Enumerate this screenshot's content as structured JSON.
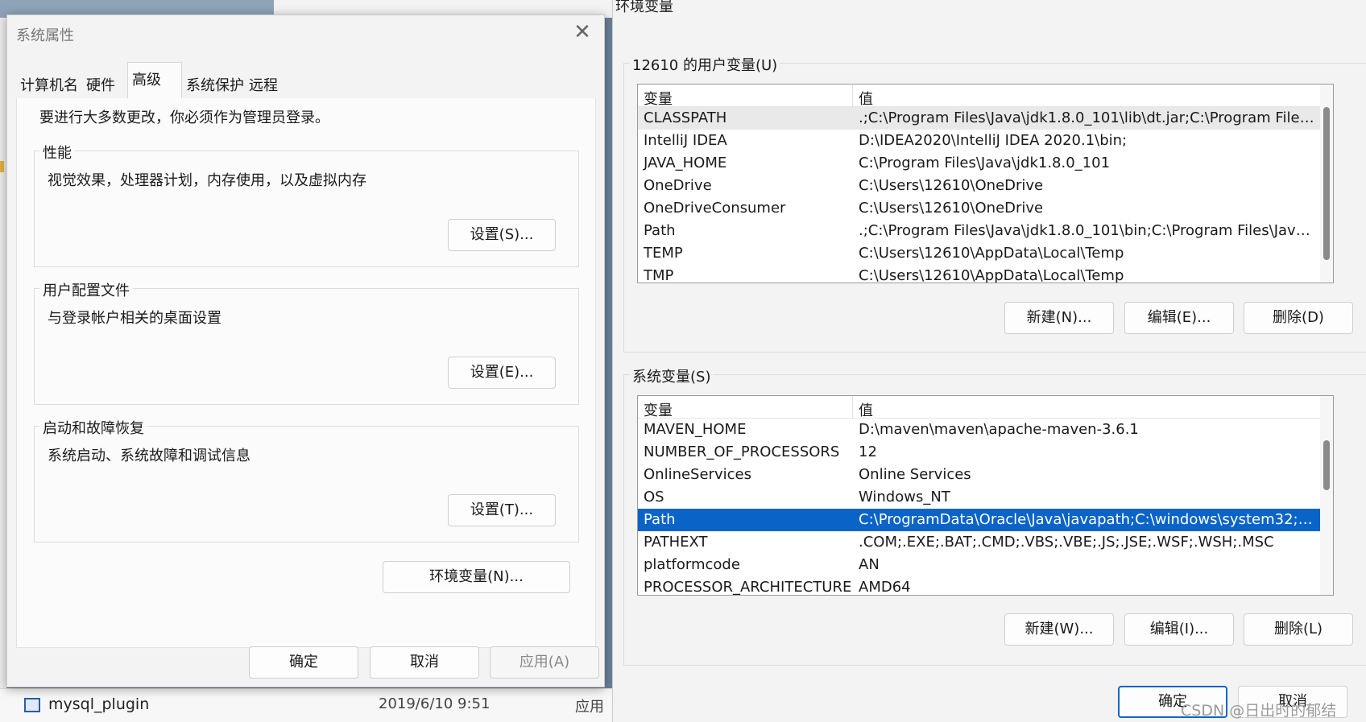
{
  "background": {
    "file_name": "mysql_plugin",
    "file_date": "2019/6/10 9:51",
    "file_type": "应用"
  },
  "system_properties": {
    "title": "系统属性",
    "close_glyph": "✕",
    "tabs": [
      "计算机名",
      "硬件",
      "高级",
      "系统保护",
      "远程"
    ],
    "active_tab": "高级",
    "admin_note": "要进行大多数更改，你必须作为管理员登录。",
    "performance": {
      "title": "性能",
      "description": "视觉效果，处理器计划，内存使用，以及虚拟内存",
      "button": "设置(S)..."
    },
    "user_profiles": {
      "title": "用户配置文件",
      "description": "与登录帐户相关的桌面设置",
      "button": "设置(E)..."
    },
    "startup_recovery": {
      "title": "启动和故障恢复",
      "description": "系统启动、系统故障和调试信息",
      "button": "设置(T)..."
    },
    "env_button": "环境变量(N)...",
    "ok": "确定",
    "cancel": "取消",
    "apply": "应用(A)"
  },
  "environment_variables": {
    "title": "环境变量",
    "user_section": {
      "title": "12610 的用户变量(U)",
      "col_variable": "变量",
      "col_value": "值",
      "rows": [
        {
          "name": "CLASSPATH",
          "value": ".;C:\\Program Files\\Java\\jdk1.8.0_101\\lib\\dt.jar;C:\\Program Files\\Jav..."
        },
        {
          "name": "IntelliJ IDEA",
          "value": "D:\\IDEA2020\\IntelliJ IDEA 2020.1\\bin;"
        },
        {
          "name": "JAVA_HOME",
          "value": "C:\\Program Files\\Java\\jdk1.8.0_101"
        },
        {
          "name": "OneDrive",
          "value": "C:\\Users\\12610\\OneDrive"
        },
        {
          "name": "OneDriveConsumer",
          "value": "C:\\Users\\12610\\OneDrive"
        },
        {
          "name": "Path",
          "value": ".;C:\\Program Files\\Java\\jdk1.8.0_101\\bin;C:\\Program Files\\Java\\jdk..."
        },
        {
          "name": "TEMP",
          "value": "C:\\Users\\12610\\AppData\\Local\\Temp"
        },
        {
          "name": "TMP",
          "value": "C:\\Users\\12610\\AppData\\Local\\Temp"
        }
      ],
      "new": "新建(N)...",
      "edit": "编辑(E)...",
      "delete": "删除(D)"
    },
    "system_section": {
      "title": "系统变量(S)",
      "col_variable": "变量",
      "col_value": "值",
      "rows": [
        {
          "name": "MAVEN_HOME",
          "value": "D:\\maven\\maven\\apache-maven-3.6.1"
        },
        {
          "name": "NUMBER_OF_PROCESSORS",
          "value": "12"
        },
        {
          "name": "OnlineServices",
          "value": "Online Services"
        },
        {
          "name": "OS",
          "value": "Windows_NT"
        },
        {
          "name": "Path",
          "value": "C:\\ProgramData\\Oracle\\Java\\javapath;C:\\windows\\system32;C:\\wi..."
        },
        {
          "name": "PATHEXT",
          "value": ".COM;.EXE;.BAT;.CMD;.VBS;.VBE;.JS;.JSE;.WSF;.WSH;.MSC"
        },
        {
          "name": "platformcode",
          "value": "AN"
        },
        {
          "name": "PROCESSOR_ARCHITECTURE",
          "value": "AMD64"
        }
      ],
      "selected_row": "Path",
      "new": "新建(W)...",
      "edit": "编辑(I)...",
      "delete": "删除(L)"
    },
    "ok": "确定",
    "cancel": "取消"
  },
  "watermark": "CSDN @日出时的郁结"
}
